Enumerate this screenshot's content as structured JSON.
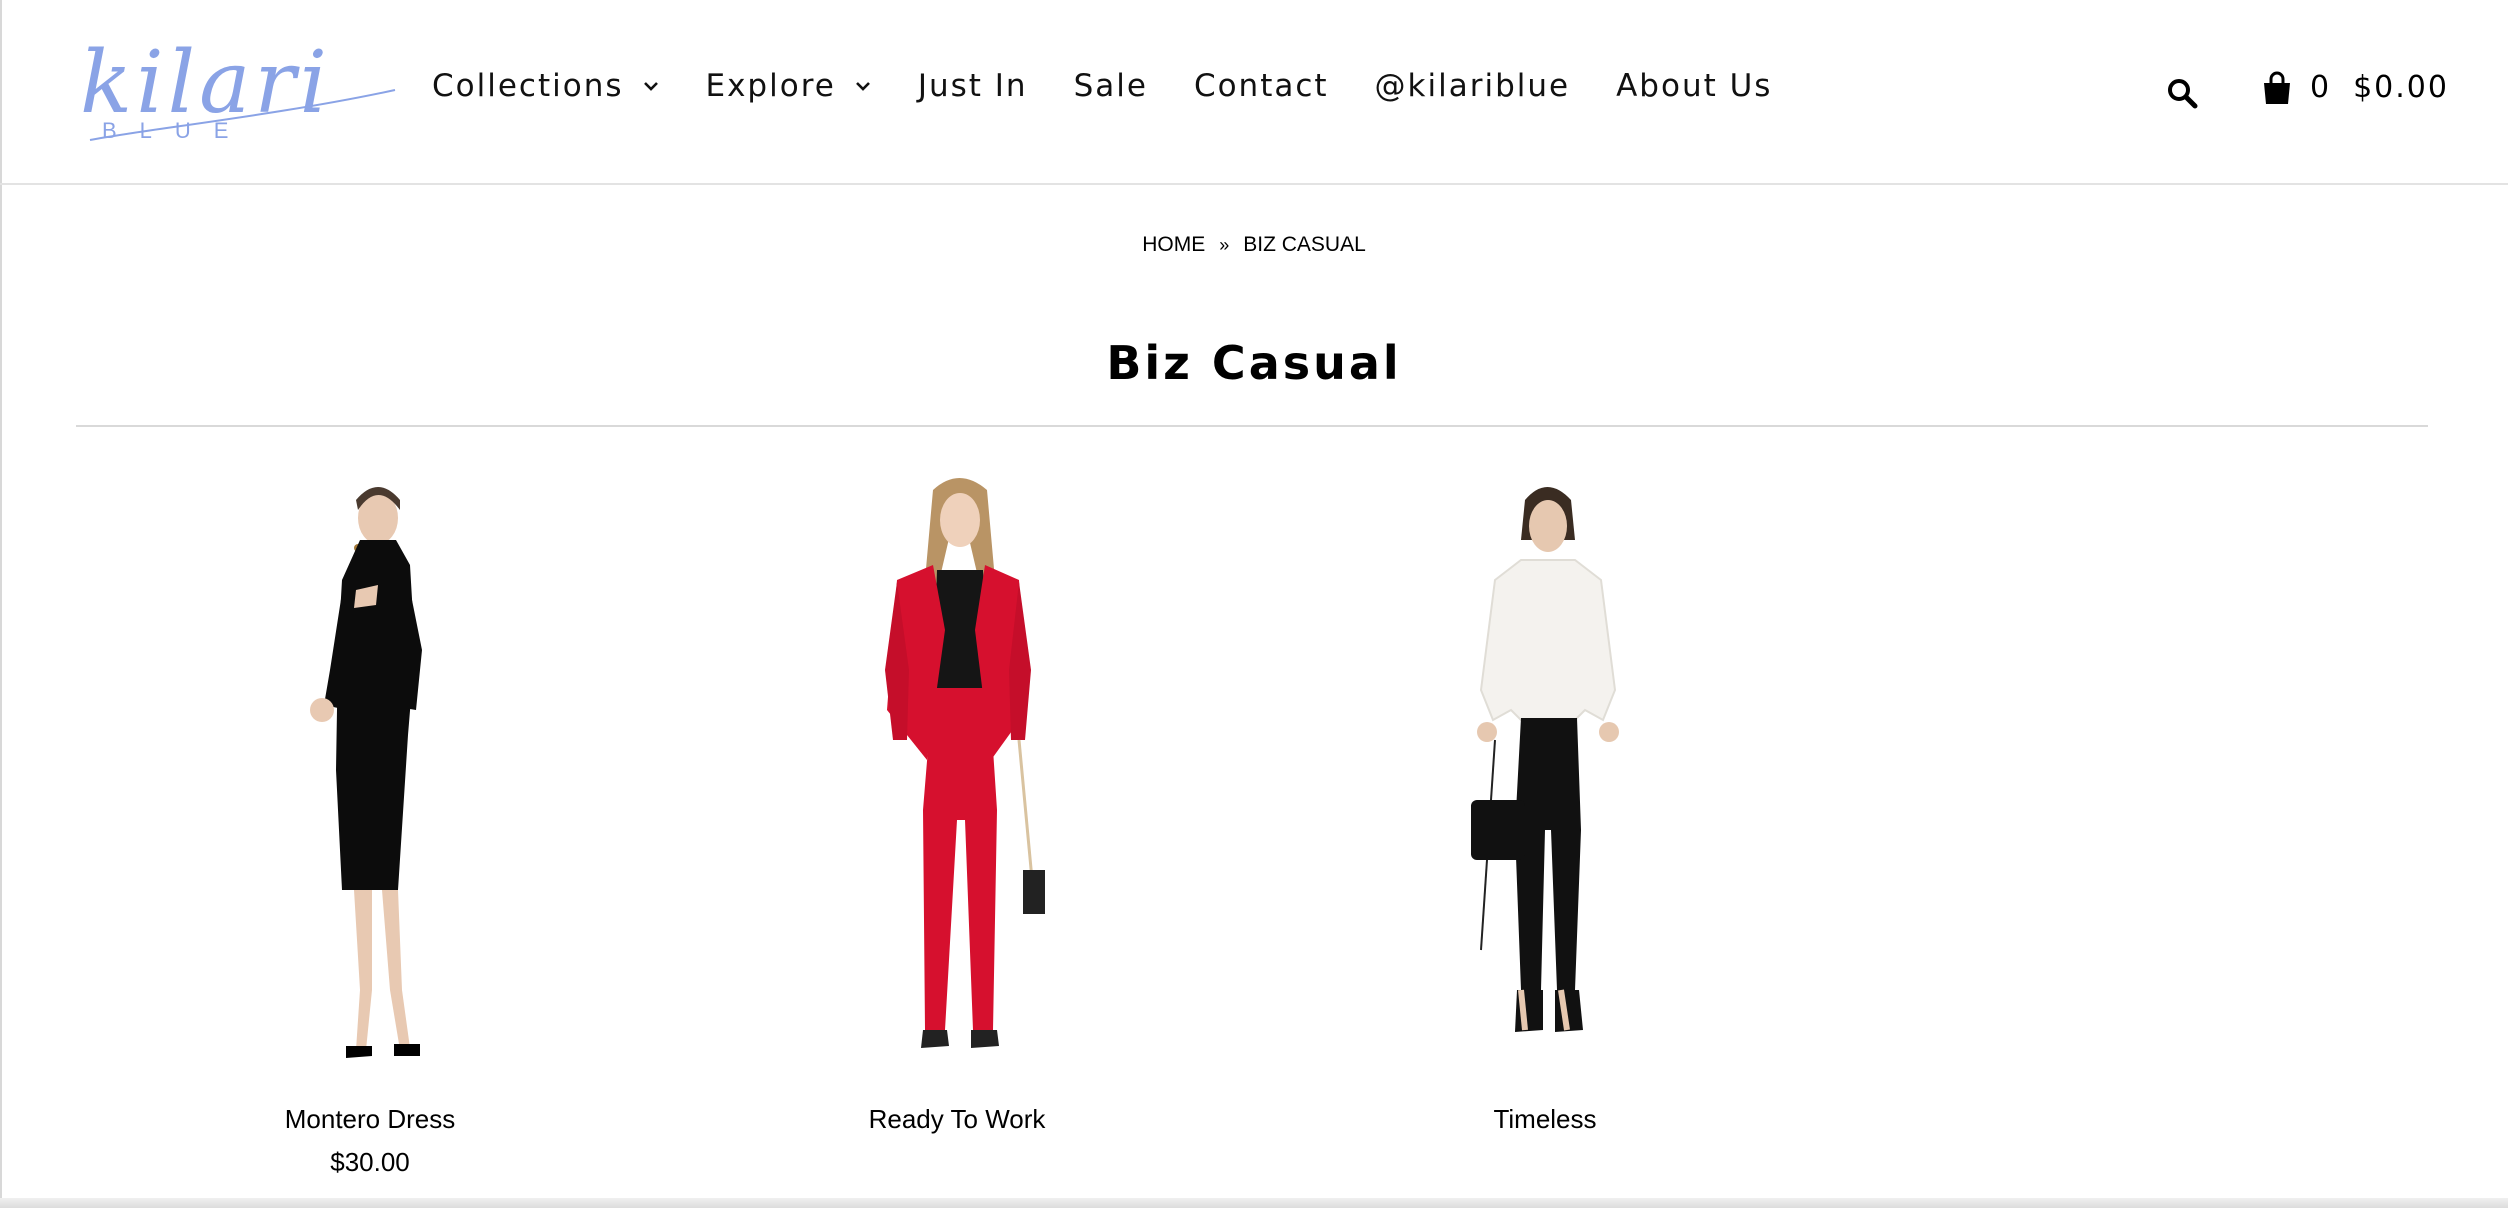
{
  "brand": {
    "script": "kilari",
    "sub": "BLUE",
    "color": "#8aa3e6"
  },
  "nav": {
    "items": [
      {
        "label": "Collections",
        "has_dropdown": true
      },
      {
        "label": "Explore",
        "has_dropdown": true
      },
      {
        "label": "Just In",
        "has_dropdown": false
      },
      {
        "label": "Sale",
        "has_dropdown": false
      },
      {
        "label": "Contact",
        "has_dropdown": false
      },
      {
        "label": "@kilariblue",
        "has_dropdown": false
      },
      {
        "label": "About Us",
        "has_dropdown": false
      }
    ]
  },
  "header_icons": {
    "search": "search-icon",
    "cart": "shopping-bag-icon"
  },
  "cart": {
    "count": "0",
    "total": "$0.00"
  },
  "breadcrumb": {
    "home": "HOME",
    "separator": "»",
    "current": "BIZ CASUAL"
  },
  "page": {
    "title": "Biz Casual"
  },
  "products": [
    {
      "name": "Montero Dress",
      "price": "$30.00"
    },
    {
      "name": "Ready To Work",
      "price": ""
    },
    {
      "name": "Timeless",
      "price": ""
    }
  ]
}
